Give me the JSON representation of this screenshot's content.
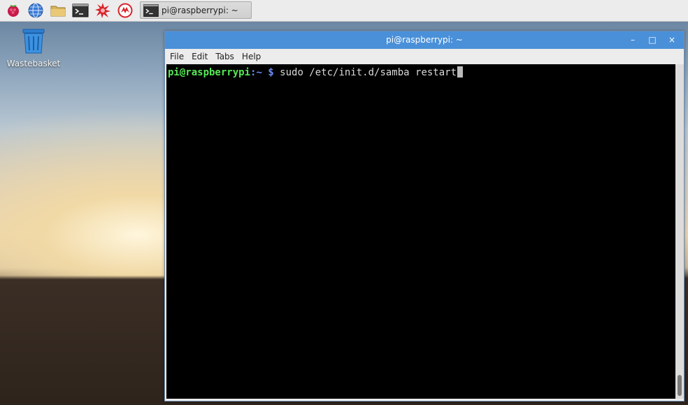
{
  "panel": {
    "launchers": [
      {
        "name": "raspberry-menu-icon",
        "color": "#c51a4a"
      },
      {
        "name": "web-browser-icon",
        "color": "#3a7bd5"
      },
      {
        "name": "file-manager-icon",
        "color": "#d8b45a"
      },
      {
        "name": "terminal-launcher-icon",
        "color": "#333333"
      },
      {
        "name": "math-kernel-icon",
        "color": "#d8222a"
      },
      {
        "name": "wolfram-icon",
        "color": "#d8222a"
      }
    ],
    "task": {
      "label": "pi@raspberrypi: ~"
    }
  },
  "desktop": {
    "icon_label": "Wastebasket"
  },
  "window": {
    "title": "pi@raspberrypi: ~",
    "buttons": {
      "minimize": "–",
      "maximize": "□",
      "close": "×"
    },
    "menu": [
      "File",
      "Edit",
      "Tabs",
      "Help"
    ]
  },
  "terminal": {
    "prompt_user": "pi@raspberrypi",
    "prompt_path": ":~ $",
    "command": " sudo /etc/init.d/samba restart"
  },
  "colors": {
    "titlebar": "#4a90d9",
    "prompt_user": "#55e855",
    "prompt_path": "#6d8df5"
  }
}
